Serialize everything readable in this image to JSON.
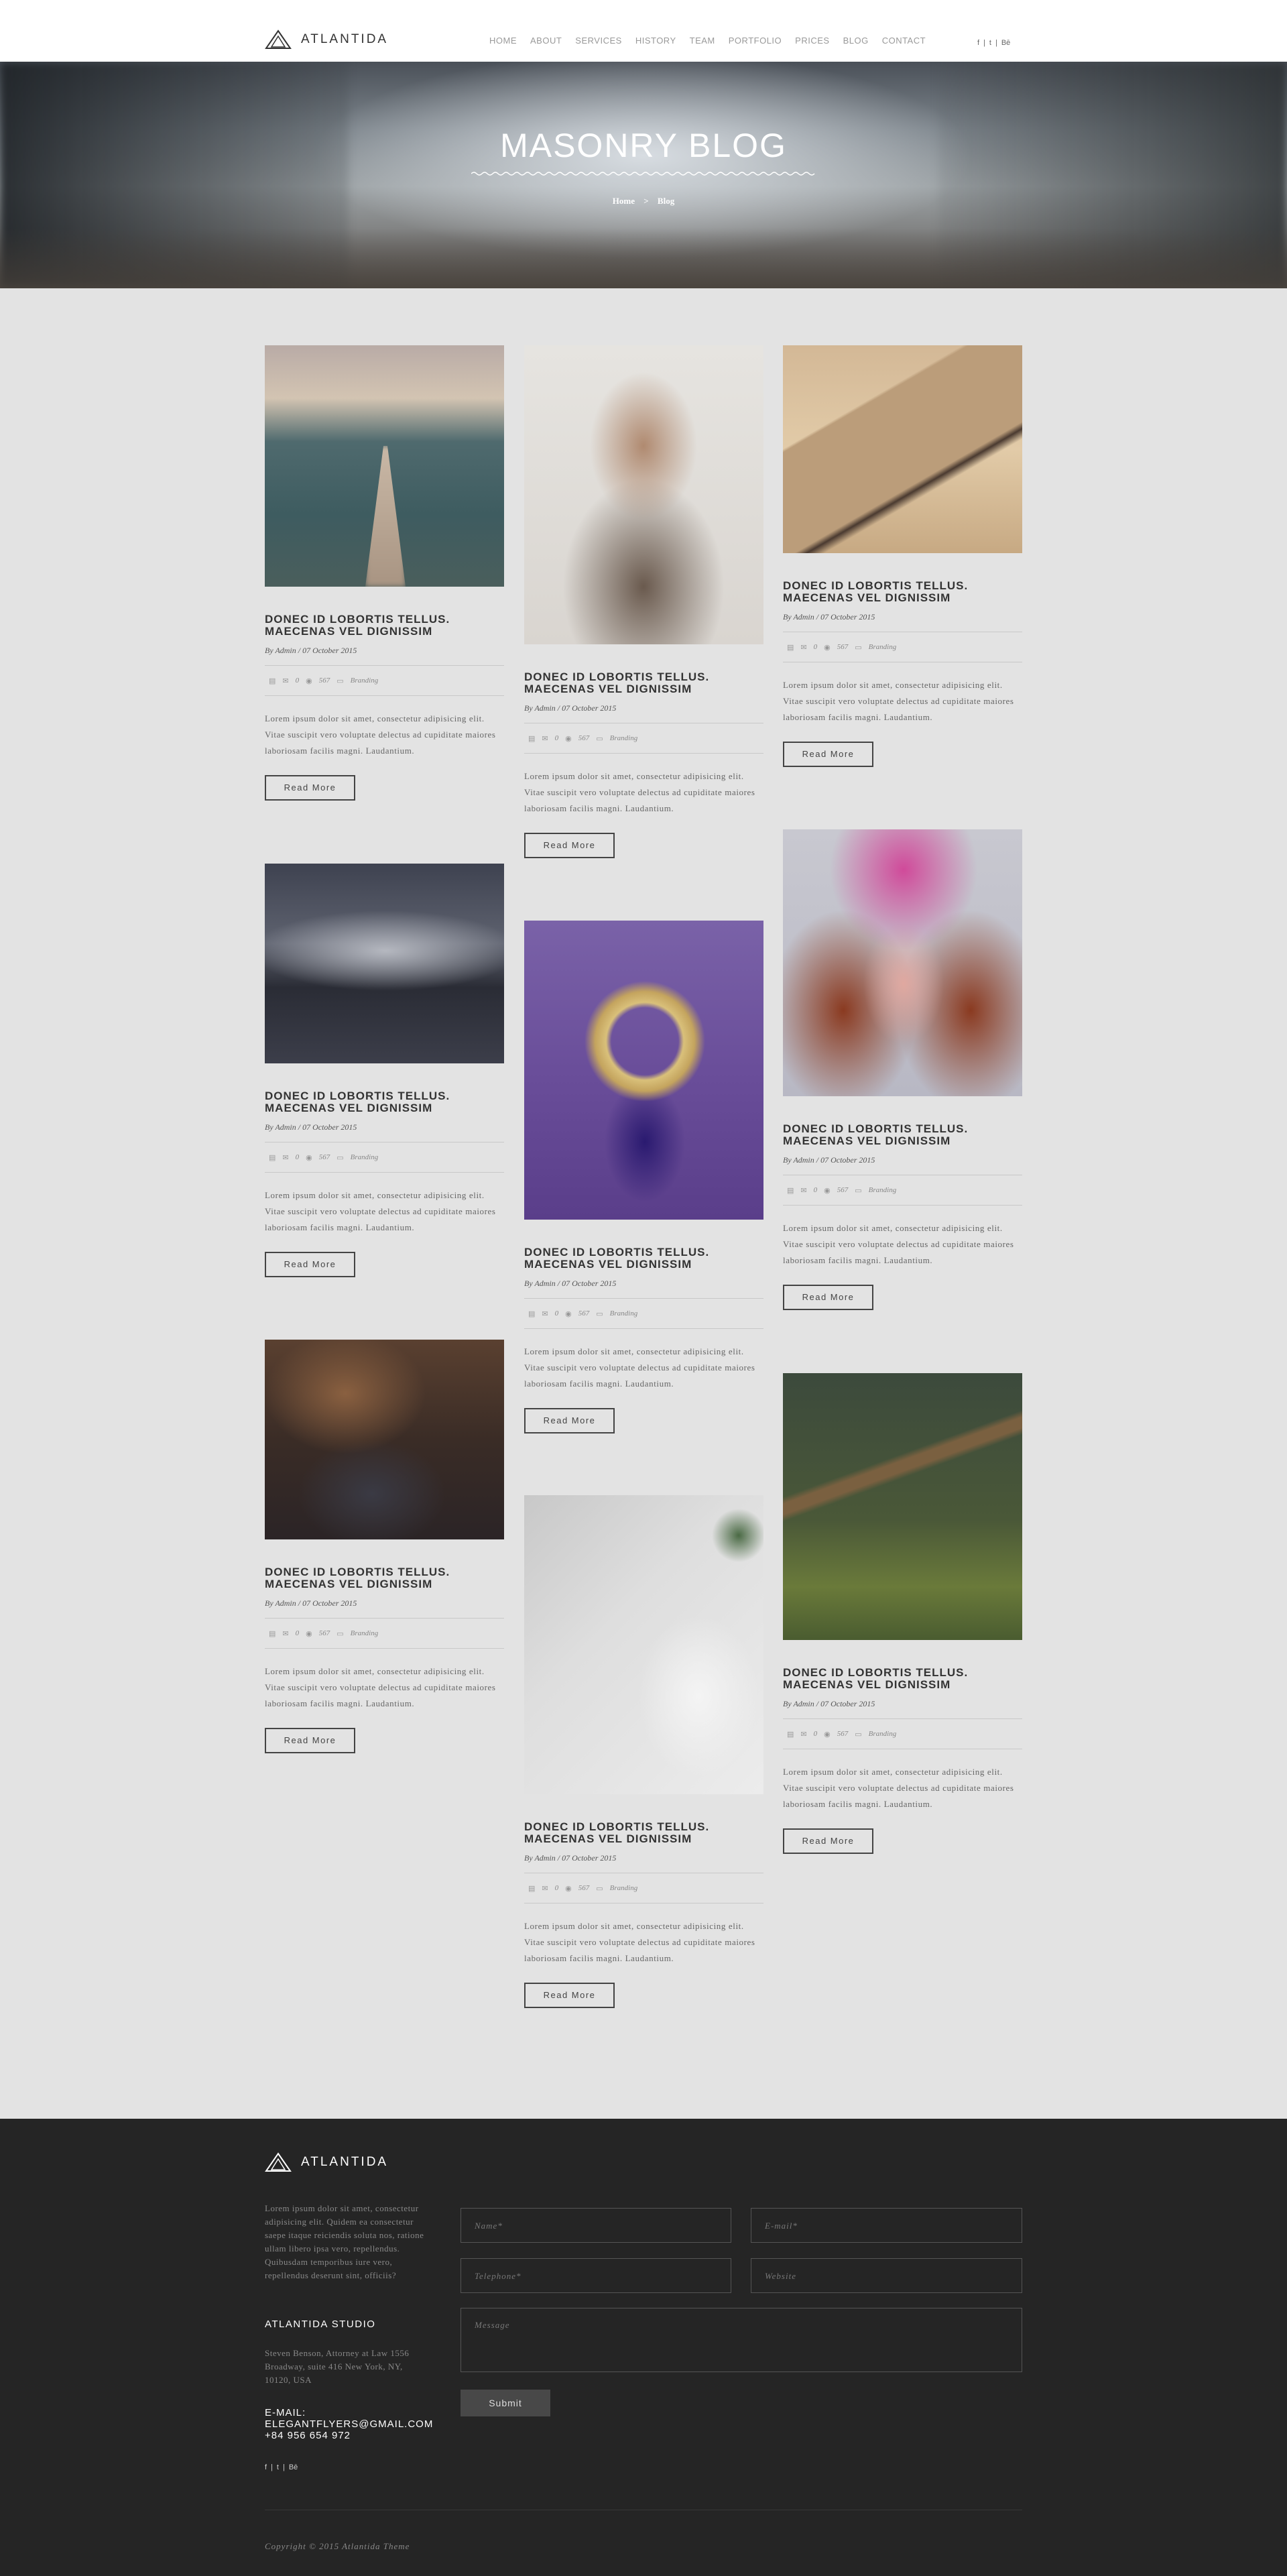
{
  "brand": {
    "name": "ATLANTIDA"
  },
  "nav": [
    "HOME",
    "ABOUT",
    "SERVICES",
    "HISTORY",
    "TEAM",
    "PORTFOLIO",
    "PRICES",
    "BLOG",
    "CONTACT"
  ],
  "social": {
    "facebook": "f",
    "twitter": "t",
    "behance": "Bē",
    "separator": "|"
  },
  "hero": {
    "title": "MASONRY BLOG",
    "breadcrumb_home": "Home",
    "breadcrumb_sep": ">",
    "breadcrumb_current": "Blog"
  },
  "posts": [
    {
      "title": "DONEC ID LOBORTIS TELLUS. MAECENAS VEL DIGNISSIM",
      "byline": "By Admin / 07 October 2015",
      "comments": "0",
      "views": "567",
      "category": "Branding",
      "excerpt": "Lorem ipsum dolor sit amet, consectetur adipisicing elit. Vitae suscipit vero voluptate delectus ad cupiditate maiores laboriosam facilis magni. Laudantium.",
      "button": "Read More"
    },
    {
      "title": "DONEC ID LOBORTIS TELLUS. MAECENAS VEL DIGNISSIM",
      "byline": "By Admin / 07 October 2015",
      "comments": "0",
      "views": "567",
      "category": "Branding",
      "excerpt": "Lorem ipsum dolor sit amet, consectetur adipisicing elit. Vitae suscipit vero voluptate delectus ad cupiditate maiores laboriosam facilis magni. Laudantium.",
      "button": "Read More"
    },
    {
      "title": "DONEC ID LOBORTIS TELLUS. MAECENAS VEL DIGNISSIM",
      "byline": "By Admin / 07 October 2015",
      "comments": "0",
      "views": "567",
      "category": "Branding",
      "excerpt": "Lorem ipsum dolor sit amet, consectetur adipisicing elit. Vitae suscipit vero voluptate delectus ad cupiditate maiores laboriosam facilis magni. Laudantium.",
      "button": "Read More"
    },
    {
      "title": "DONEC ID LOBORTIS TELLUS. MAECENAS VEL DIGNISSIM",
      "byline": "By Admin / 07 October 2015",
      "comments": "0",
      "views": "567",
      "category": "Branding",
      "excerpt": "Lorem ipsum dolor sit amet, consectetur adipisicing elit. Vitae suscipit vero voluptate delectus ad cupiditate maiores laboriosam facilis magni. Laudantium.",
      "button": "Read More"
    },
    {
      "title": "DONEC ID LOBORTIS TELLUS. MAECENAS VEL DIGNISSIM",
      "byline": "By Admin / 07 October 2015",
      "comments": "0",
      "views": "567",
      "category": "Branding",
      "excerpt": "Lorem ipsum dolor sit amet, consectetur adipisicing elit. Vitae suscipit vero voluptate delectus ad cupiditate maiores laboriosam facilis magni. Laudantium.",
      "button": "Read More"
    },
    {
      "title": "DONEC ID LOBORTIS TELLUS. MAECENAS VEL DIGNISSIM",
      "byline": "By Admin / 07 October 2015",
      "comments": "0",
      "views": "567",
      "category": "Branding",
      "excerpt": "Lorem ipsum dolor sit amet, consectetur adipisicing elit. Vitae suscipit vero voluptate delectus ad cupiditate maiores laboriosam facilis magni. Laudantium.",
      "button": "Read More"
    },
    {
      "title": "DONEC ID LOBORTIS TELLUS. MAECENAS VEL DIGNISSIM",
      "byline": "By Admin / 07 October 2015",
      "comments": "0",
      "views": "567",
      "category": "Branding",
      "excerpt": "Lorem ipsum dolor sit amet, consectetur adipisicing elit. Vitae suscipit vero voluptate delectus ad cupiditate maiores laboriosam facilis magni. Laudantium.",
      "button": "Read More"
    },
    {
      "title": "DONEC ID LOBORTIS TELLUS. MAECENAS VEL DIGNISSIM",
      "byline": "By Admin / 07 October 2015",
      "comments": "0",
      "views": "567",
      "category": "Branding",
      "excerpt": "Lorem ipsum dolor sit amet, consectetur adipisicing elit. Vitae suscipit vero voluptate delectus ad cupiditate maiores laboriosam facilis magni. Laudantium.",
      "button": "Read More"
    },
    {
      "title": "DONEC ID LOBORTIS TELLUS. MAECENAS VEL DIGNISSIM",
      "byline": "By Admin / 07 October 2015",
      "comments": "0",
      "views": "567",
      "category": "Branding",
      "excerpt": "Lorem ipsum dolor sit amet, consectetur adipisicing elit. Vitae suscipit vero voluptate delectus ad cupiditate maiores laboriosam facilis magni. Laudantium.",
      "button": "Read More"
    }
  ],
  "footer": {
    "brand": "ATLANTIDA",
    "description": "Lorem ipsum dolor sit amet, consectetur adipisicing elit. Quidem ea consectetur saepe itaque reiciendis soluta nos, ratione ullam libero ipsa vero, repellendus. Quibusdam temporibus iure vero, repellendus deserunt sint, officiis?",
    "studio_title": "ATLANTIDA STUDIO",
    "address": "Steven Benson, Attorney at Law 1556 Broadway, suite 416 New York, NY, 10120, USA",
    "email_label": "E-MAIL:",
    "email": "ELEGANTFLYERS@GMAIL.COM",
    "phone": "+84 956 654 972",
    "form": {
      "name_placeholder": "Name*",
      "email_placeholder": "E-mail*",
      "phone_placeholder": "Telephone*",
      "website_placeholder": "Website",
      "message_placeholder": "Message",
      "submit": "Submit"
    },
    "copyright": "Copyright © 2015 Atlantida Theme"
  }
}
